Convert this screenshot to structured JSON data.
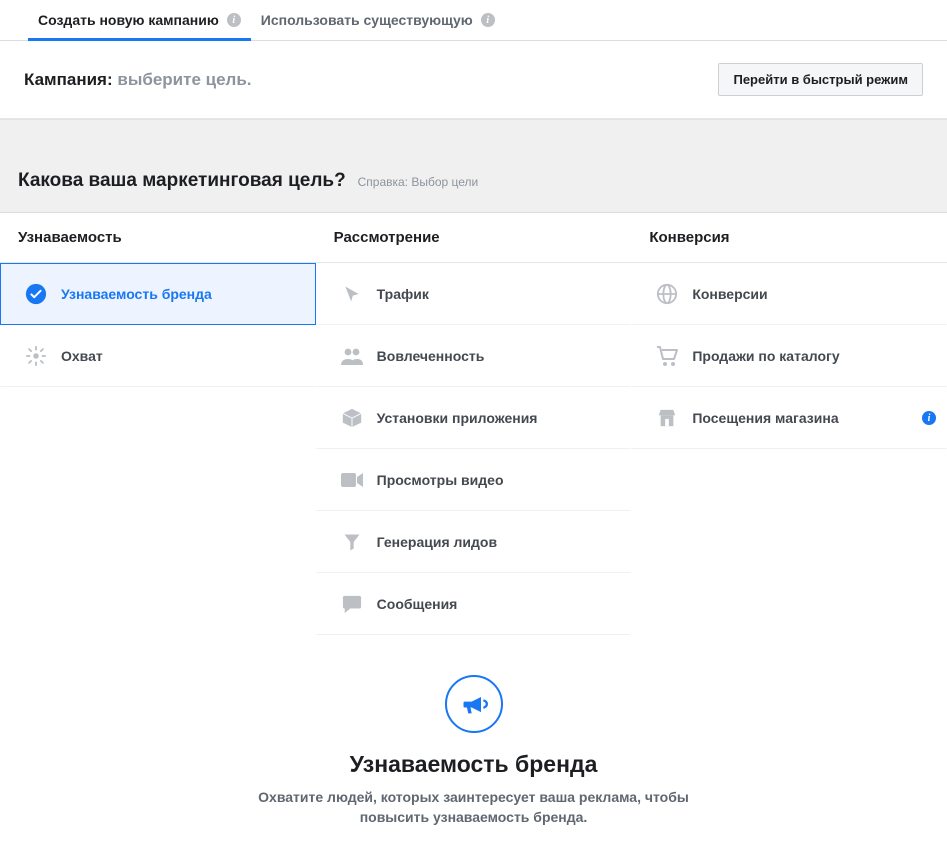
{
  "tabs": {
    "create": "Создать новую кампанию",
    "use_existing": "Использовать существующую"
  },
  "subheader": {
    "label": "Кампания:",
    "hint": "выберите цель.",
    "fast_mode": "Перейти в быстрый режим"
  },
  "question": {
    "title": "Какова ваша маркетинговая цель?",
    "help": "Справка: Выбор цели"
  },
  "columns": {
    "awareness": "Узнаваемость",
    "consideration": "Рассмотрение",
    "conversion": "Конверсия"
  },
  "goals": {
    "brand_awareness": "Узнаваемость бренда",
    "reach": "Охват",
    "traffic": "Трафик",
    "engagement": "Вовлеченность",
    "app_installs": "Установки приложения",
    "video_views": "Просмотры видео",
    "lead_gen": "Генерация лидов",
    "messages": "Сообщения",
    "conversions": "Конверсии",
    "catalog_sales": "Продажи по каталогу",
    "store_visits": "Посещения магазина"
  },
  "detail": {
    "title": "Узнаваемость бренда",
    "description": "Охватите людей, которых заинтересует ваша реклама, чтобы повысить узнаваемость бренда."
  }
}
